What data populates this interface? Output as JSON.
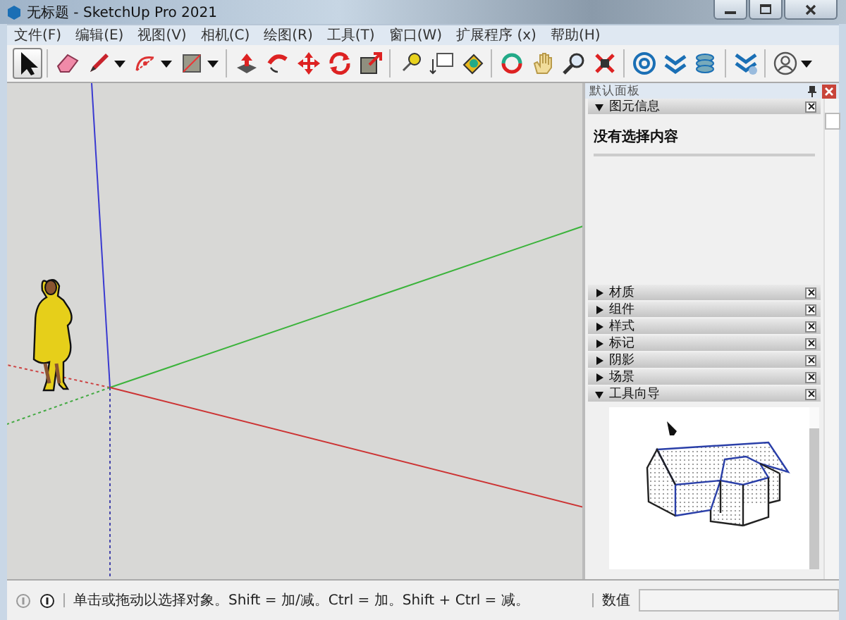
{
  "window": {
    "title": "无标题 - SketchUp Pro 2021"
  },
  "menu": [
    "文件(F)",
    "编辑(E)",
    "视图(V)",
    "相机(C)",
    "绘图(R)",
    "工具(T)",
    "窗口(W)",
    "扩展程序 (x)",
    "帮助(H)"
  ],
  "toolbar": [
    {
      "kind": "select",
      "selected": true,
      "menu": false
    },
    {
      "kind": "separator"
    },
    {
      "kind": "eraser",
      "selected": false,
      "menu": false
    },
    {
      "kind": "pencil",
      "selected": false,
      "menu": true
    },
    {
      "kind": "arc",
      "selected": false,
      "menu": true
    },
    {
      "kind": "rectangle",
      "selected": false,
      "menu": true
    },
    {
      "kind": "separator"
    },
    {
      "kind": "pushpull",
      "selected": false,
      "menu": false
    },
    {
      "kind": "followme",
      "selected": false,
      "menu": false
    },
    {
      "kind": "move",
      "selected": false,
      "menu": false
    },
    {
      "kind": "rotate",
      "selected": false,
      "menu": false
    },
    {
      "kind": "scale",
      "selected": false,
      "menu": false
    },
    {
      "kind": "separator"
    },
    {
      "kind": "tape",
      "selected": false,
      "menu": false
    },
    {
      "kind": "text",
      "selected": false,
      "menu": false
    },
    {
      "kind": "paint",
      "selected": false,
      "menu": false
    },
    {
      "kind": "separator"
    },
    {
      "kind": "orbit",
      "selected": false,
      "menu": false
    },
    {
      "kind": "pan",
      "selected": false,
      "menu": false
    },
    {
      "kind": "zoom",
      "selected": false,
      "menu": false
    },
    {
      "kind": "zoomext",
      "selected": false,
      "menu": false
    },
    {
      "kind": "separator"
    },
    {
      "kind": "warehouse",
      "selected": false,
      "menu": false
    },
    {
      "kind": "extension",
      "selected": false,
      "menu": false
    },
    {
      "kind": "layers",
      "selected": false,
      "menu": false
    },
    {
      "kind": "separator"
    },
    {
      "kind": "sandbox",
      "selected": false,
      "menu": false
    },
    {
      "kind": "separator"
    },
    {
      "kind": "profile",
      "selected": false,
      "menu": true
    }
  ],
  "panel": {
    "title": "默认面板",
    "trays": [
      {
        "label": "图元信息",
        "expanded": true,
        "kind": "entity_info",
        "content": "没有选择内容"
      },
      {
        "label": "材质",
        "expanded": false
      },
      {
        "label": "组件",
        "expanded": false
      },
      {
        "label": "样式",
        "expanded": false
      },
      {
        "label": "标记",
        "expanded": false
      },
      {
        "label": "阴影",
        "expanded": false
      },
      {
        "label": "场景",
        "expanded": false
      },
      {
        "label": "工具向导",
        "expanded": true,
        "kind": "instructor"
      }
    ]
  },
  "status_bar": {
    "message": "单击或拖动以选择对象。Shift = 加/减。Ctrl = 加。Shift + Ctrl = 减。",
    "measurements": {
      "label": "数值"
    }
  }
}
